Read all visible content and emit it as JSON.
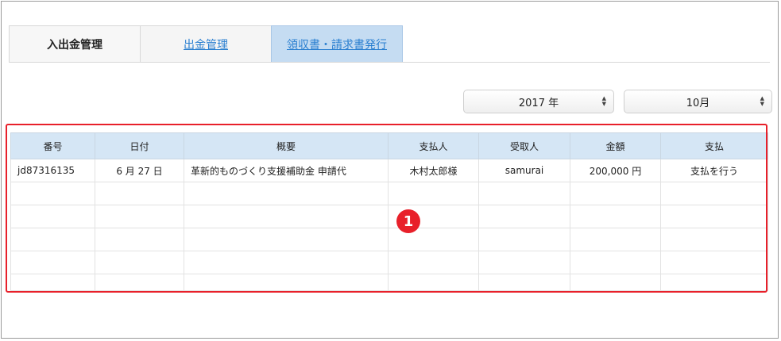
{
  "tabs": [
    {
      "label": "入出金管理"
    },
    {
      "label": "出金管理"
    },
    {
      "label": "領収書・請求書発行"
    }
  ],
  "filters": {
    "year": "2017 年",
    "month": "10月"
  },
  "table": {
    "headers": [
      "番号",
      "日付",
      "概要",
      "支払人",
      "受取人",
      "金額",
      "支払"
    ],
    "row": {
      "id": "jd87316135",
      "date": "6 月 27 日",
      "summary": "革新的ものづくり支援補助金 申請代",
      "payer": "木村太郎様",
      "payee": "samurai",
      "amount": "200,000 円",
      "action": "支払を行う"
    }
  },
  "annotation": {
    "marker": "1",
    "color": "#e8202a"
  }
}
